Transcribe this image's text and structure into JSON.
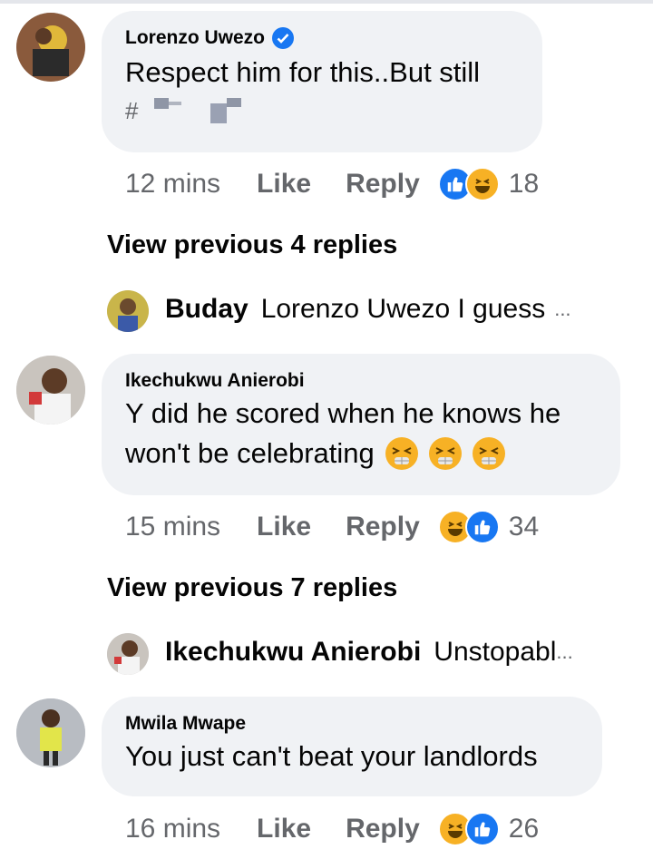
{
  "comments": [
    {
      "author": "Lorenzo Uwezo",
      "verified": true,
      "text_line1": "Respect him for this..But still",
      "text_line2": "#",
      "time": "12 mins",
      "like": "Like",
      "reply": "Reply",
      "reactions": [
        "like",
        "haha"
      ],
      "reaction_count": "18"
    },
    {
      "author": "Ikechukwu Anierobi",
      "text_line1": "Y did he scored when he knows he",
      "text_line2": "won't be celebrating",
      "emojis": [
        "tired-face",
        "tired-face",
        "tired-face"
      ],
      "time": "15 mins",
      "like": "Like",
      "reply": "Reply",
      "reactions": [
        "haha",
        "like"
      ],
      "reaction_count": "34"
    },
    {
      "author": "Mwila Mwape",
      "text_line1": "You just can't beat your landlords",
      "time": "16 mins",
      "like": "Like",
      "reply": "Reply",
      "reactions": [
        "haha",
        "like"
      ],
      "reaction_count": "26"
    }
  ],
  "thread1": {
    "view_previous": "View previous 4 replies",
    "reply_name": "Buday",
    "reply_snippet": "Lorenzo Uwezo I guess",
    "ellipsis": "..."
  },
  "thread2": {
    "view_previous": "View previous 7 replies",
    "reply_name": "Ikechukwu Anierobi",
    "reply_snippet": "Unstopabl",
    "ellipsis": "..."
  },
  "colors": {
    "bubble": "#f0f2f5",
    "meta": "#65676b",
    "like_blue": "#1877f2",
    "haha_yellow": "#f7b125"
  }
}
